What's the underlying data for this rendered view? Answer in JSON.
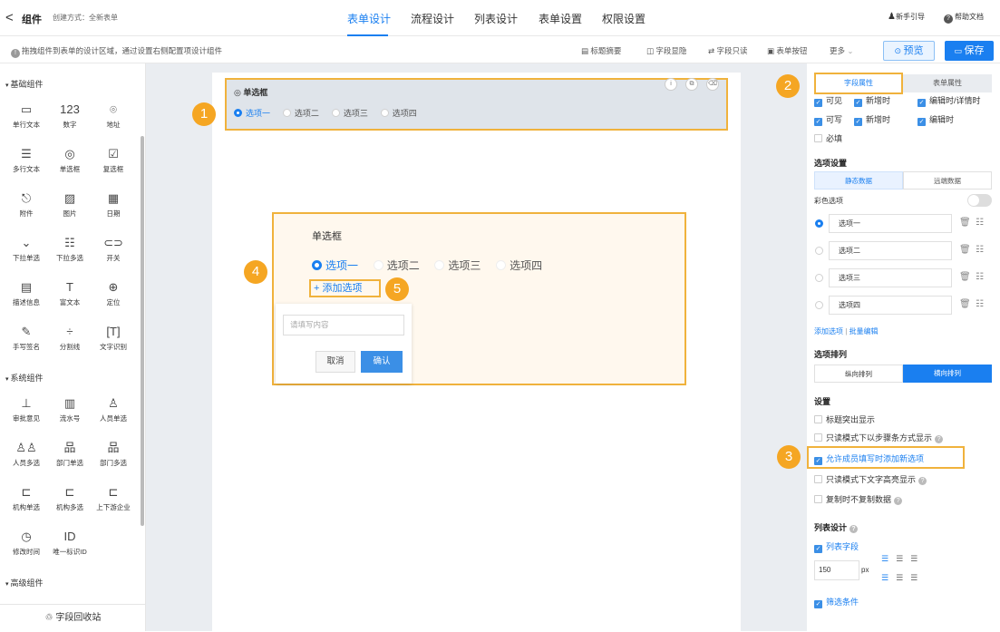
{
  "topbar": {
    "back": "<",
    "title": "组件",
    "create_mode": "创建方式：全新表单",
    "tabs": [
      "表单设计",
      "流程设计",
      "列表设计",
      "表单设置",
      "权限设置"
    ],
    "guide": "新手引导",
    "help": "帮助文档"
  },
  "subbar": {
    "hint": "拖拽组件到表单的设计区域，通过设置右侧配置项设计组件",
    "tools": [
      "标题摘要",
      "字段显隐",
      "字段只读",
      "表单按钮",
      "更多"
    ],
    "preview": "预览",
    "save": "保存"
  },
  "left": {
    "sections": [
      "基础组件",
      "系统组件",
      "高级组件"
    ],
    "basic": [
      {
        "icon": "▭",
        "label": "单行文本"
      },
      {
        "icon": "123",
        "label": "数字"
      },
      {
        "icon": "⌾",
        "label": "地址"
      },
      {
        "icon": "☰",
        "label": "多行文本"
      },
      {
        "icon": "◎",
        "label": "单选框"
      },
      {
        "icon": "☑",
        "label": "复选框"
      },
      {
        "icon": "⎋",
        "label": "附件"
      },
      {
        "icon": "▨",
        "label": "图片"
      },
      {
        "icon": "▦",
        "label": "日期"
      },
      {
        "icon": "⌄",
        "label": "下拉单选"
      },
      {
        "icon": "☷",
        "label": "下拉多选"
      },
      {
        "icon": "⊂⊃",
        "label": "开关"
      },
      {
        "icon": "▤",
        "label": "描述信息"
      },
      {
        "icon": "T",
        "label": "富文本"
      },
      {
        "icon": "⊕",
        "label": "定位"
      },
      {
        "icon": "✎",
        "label": "手写签名"
      },
      {
        "icon": "÷",
        "label": "分割线"
      },
      {
        "icon": "[T]",
        "label": "文字识别"
      }
    ],
    "system": [
      {
        "icon": "⊥",
        "label": "审批意见"
      },
      {
        "icon": "▥",
        "label": "流水号"
      },
      {
        "icon": "♙",
        "label": "人员单选"
      },
      {
        "icon": "♙♙",
        "label": "人员多选"
      },
      {
        "icon": "品",
        "label": "部门单选"
      },
      {
        "icon": "品",
        "label": "部门多选"
      },
      {
        "icon": "⊏",
        "label": "机构单选"
      },
      {
        "icon": "⊏",
        "label": "机构多选"
      },
      {
        "icon": "⊏",
        "label": "上下游企业"
      },
      {
        "icon": "◷",
        "label": "修改时间"
      },
      {
        "icon": "ID",
        "label": "唯一标识ID"
      }
    ],
    "recycle": "字段回收站"
  },
  "canvas": {
    "field_title": "单选框",
    "options": [
      "选项一",
      "选项二",
      "选项三",
      "选项四"
    ]
  },
  "zoom": {
    "title": "单选框",
    "options": [
      "选项一",
      "选项二",
      "选项三",
      "选项四"
    ],
    "add_option": "添加选项",
    "placeholder": "请填写内容",
    "cancel": "取消",
    "confirm": "确认"
  },
  "callouts": [
    "1",
    "2",
    "3",
    "4",
    "5"
  ],
  "right": {
    "tabs": [
      "字段属性",
      "表单属性"
    ],
    "row1": [
      "可见",
      "新增时",
      "编辑时/详情时"
    ],
    "row2": [
      "可写",
      "新增时",
      "编辑时"
    ],
    "required": "必填",
    "opt_settings": "选项设置",
    "data_tabs": [
      "静态数据",
      "远端数据"
    ],
    "color_opt": "彩色选项",
    "options": [
      "选项一",
      "选项二",
      "选项三",
      "选项四"
    ],
    "add_opt": "添加选项",
    "batch_edit": "批量编辑",
    "sep": "|",
    "arrange": "选项排列",
    "arrange_tabs": [
      "纵向排列",
      "横向排列"
    ],
    "settings": "设置",
    "setting_items": [
      "标题突出显示",
      "只读模式下以步骤条方式显示",
      "允许成员填写时添加新选项",
      "只读模式下文字高亮显示",
      "复制时不复制数据"
    ],
    "list_design": "列表设计",
    "list_field": "列表字段",
    "width": "150",
    "unit": "px",
    "filter": "筛选条件"
  }
}
